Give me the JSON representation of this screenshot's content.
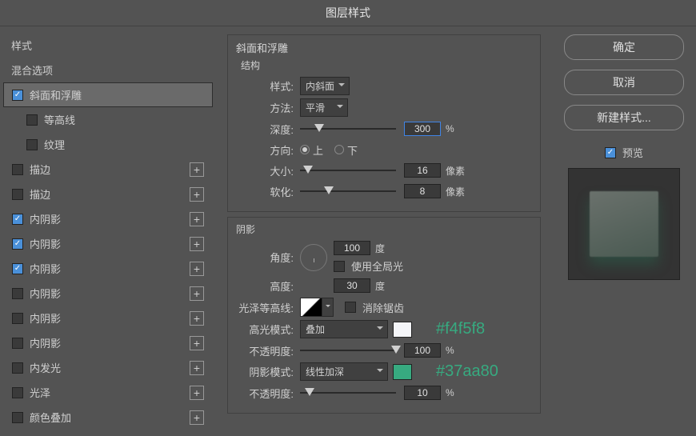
{
  "title": "图层样式",
  "sidebar": {
    "heads": {
      "styles": "样式",
      "blend": "混合选项"
    },
    "items": [
      {
        "label": "斜面和浮雕",
        "checked": true,
        "selected": true,
        "expandable": false
      },
      {
        "label": "等高线",
        "checked": false,
        "sub": true
      },
      {
        "label": "纹理",
        "checked": false,
        "sub": true
      },
      {
        "label": "描边",
        "checked": false,
        "expandable": true
      },
      {
        "label": "描边",
        "checked": false,
        "expandable": true
      },
      {
        "label": "内阴影",
        "checked": true,
        "expandable": true
      },
      {
        "label": "内阴影",
        "checked": true,
        "expandable": true
      },
      {
        "label": "内阴影",
        "checked": true,
        "expandable": true
      },
      {
        "label": "内阴影",
        "checked": false,
        "expandable": true
      },
      {
        "label": "内阴影",
        "checked": false,
        "expandable": true
      },
      {
        "label": "内阴影",
        "checked": false,
        "expandable": true
      },
      {
        "label": "内发光",
        "checked": false,
        "expandable": true
      },
      {
        "label": "光泽",
        "checked": false,
        "expandable": true
      },
      {
        "label": "颜色叠加",
        "checked": false,
        "expandable": true
      }
    ]
  },
  "main": {
    "panel_title": "斜面和浮雕",
    "structure": {
      "title": "结构",
      "style_label": "样式:",
      "style_value": "内斜面",
      "method_label": "方法:",
      "method_value": "平滑",
      "depth_label": "深度:",
      "depth_value": "300",
      "depth_unit": "%",
      "direction_label": "方向:",
      "up": "上",
      "down": "下",
      "size_label": "大小:",
      "size_value": "16",
      "size_unit": "像素",
      "soften_label": "软化:",
      "soften_value": "8",
      "soften_unit": "像素"
    },
    "shading": {
      "title": "阴影",
      "angle_label": "角度:",
      "angle_value": "100",
      "angle_unit": "度",
      "global_light": "使用全局光",
      "altitude_label": "高度:",
      "altitude_value": "30",
      "altitude_unit": "度",
      "gloss_label": "光泽等高线:",
      "anti_alias": "消除锯齿",
      "highlight_mode_label": "高光模式:",
      "highlight_mode_value": "叠加",
      "highlight_swatch": "#f4f5f8",
      "opacity1_label": "不透明度:",
      "opacity1_value": "100",
      "opacity1_unit": "%",
      "shadow_mode_label": "阴影模式:",
      "shadow_mode_value": "线性加深",
      "shadow_swatch": "#37aa80",
      "opacity2_label": "不透明度:",
      "opacity2_value": "10",
      "opacity2_unit": "%"
    }
  },
  "right": {
    "ok": "确定",
    "cancel": "取消",
    "new_style": "新建样式...",
    "preview": "预览"
  },
  "annotations": {
    "highlight_hex": "#f4f5f8",
    "shadow_hex": "#37aa80"
  }
}
